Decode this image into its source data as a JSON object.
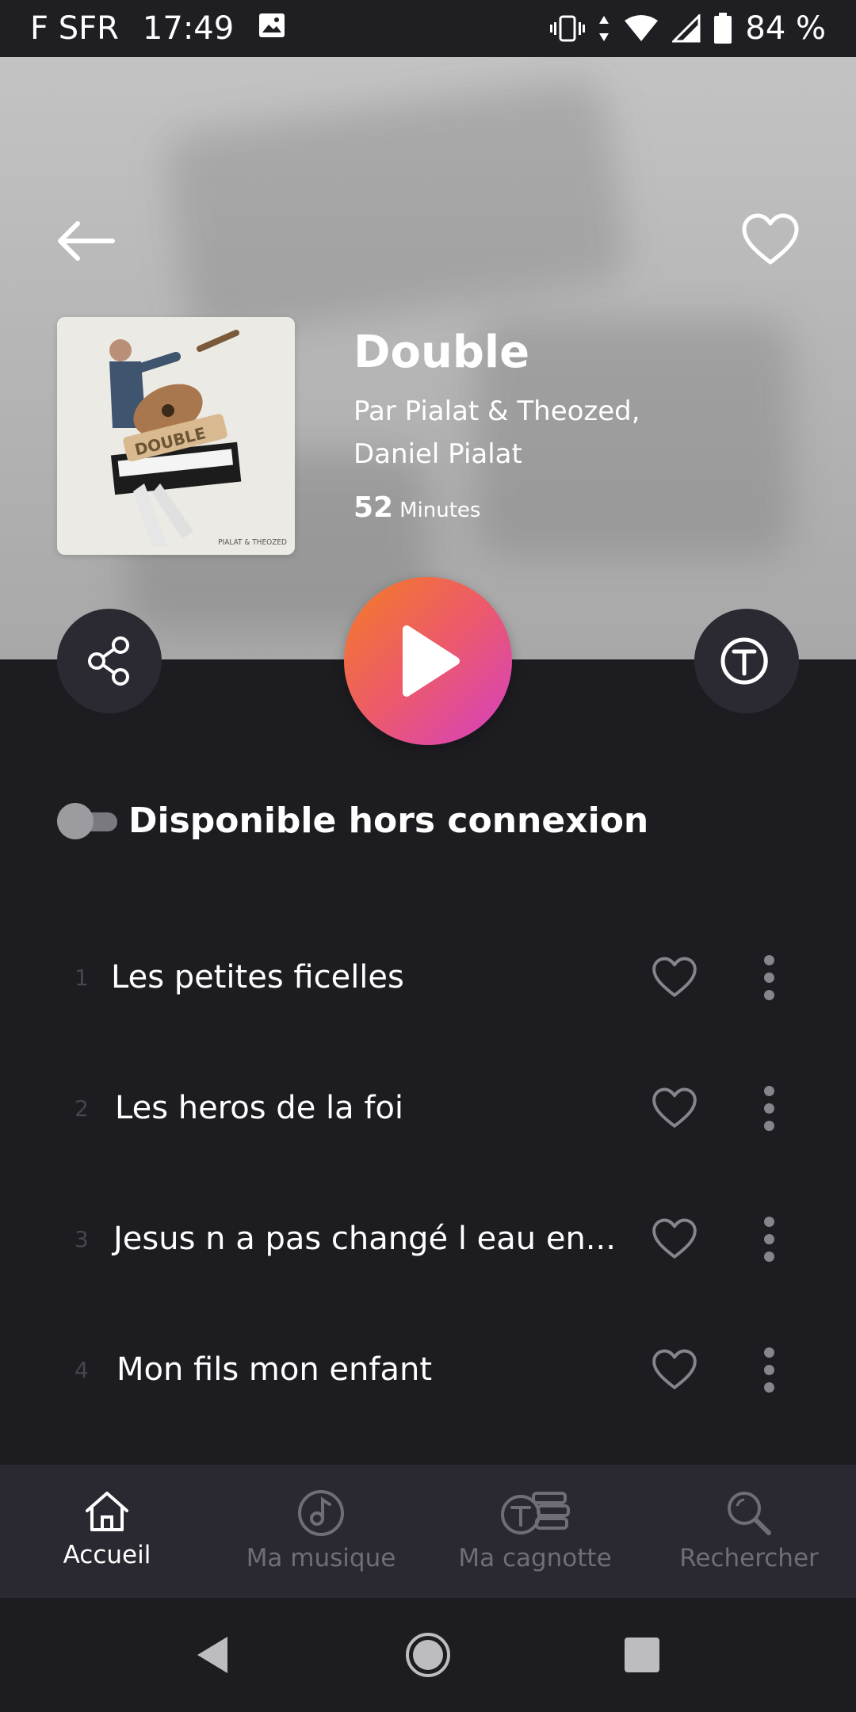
{
  "status_bar": {
    "carrier": "F SFR",
    "time": "17:49",
    "battery": "84 %"
  },
  "album": {
    "title": "Double",
    "artist": "Par Pialat & Theozed, Daniel Pialat",
    "duration_value": "52",
    "duration_unit": "Minutes",
    "cover_word": "DOUBLE",
    "cover_brand": "PIALAT & THEOZED"
  },
  "offline": {
    "label": "Disponible hors connexion",
    "enabled": false
  },
  "tracks": [
    {
      "number": "1",
      "title": "Les petites ficelles"
    },
    {
      "number": "2",
      "title": "Les heros de la foi"
    },
    {
      "number": "3",
      "title": "Jesus n a pas changé l eau en..."
    },
    {
      "number": "4",
      "title": "Mon fils mon enfant"
    }
  ],
  "bottom_nav": [
    {
      "label": "Accueil",
      "icon": "home-icon",
      "active": true
    },
    {
      "label": "Ma musique",
      "icon": "music-disc-icon",
      "active": false
    },
    {
      "label": "Ma cagnotte",
      "icon": "coins-icon",
      "active": false
    },
    {
      "label": "Rechercher",
      "icon": "search-icon",
      "active": false
    }
  ],
  "colors": {
    "background": "#1d1c21",
    "play_gradient_start": "#f57c24",
    "play_gradient_end": "#d53fc4",
    "nav_background": "#2a2932",
    "inactive_text": "#6f6e76"
  }
}
